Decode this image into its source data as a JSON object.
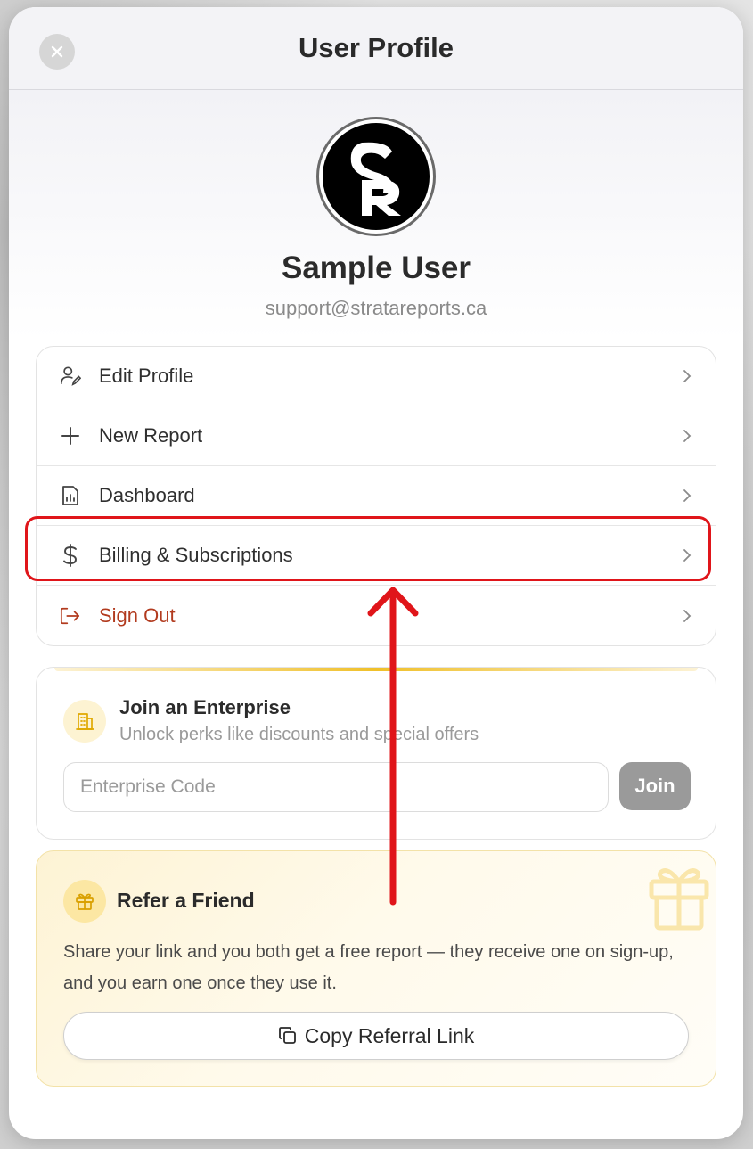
{
  "header": {
    "title": "User Profile",
    "close_icon": "close-icon"
  },
  "profile": {
    "avatar_initials": "SR",
    "name": "Sample User",
    "email": "support@stratareports.ca"
  },
  "menu": {
    "items": [
      {
        "label": "Edit Profile",
        "icon": "user-edit-icon"
      },
      {
        "label": "New Report",
        "icon": "plus-icon"
      },
      {
        "label": "Dashboard",
        "icon": "report-chart-icon"
      },
      {
        "label": "Billing & Subscriptions",
        "icon": "dollar-icon"
      },
      {
        "label": "Sign Out",
        "icon": "sign-out-icon"
      }
    ]
  },
  "enterprise": {
    "title": "Join an Enterprise",
    "subtitle": "Unlock perks like discounts and special offers",
    "input_placeholder": "Enterprise Code",
    "input_value": "",
    "join_label": "Join"
  },
  "referral": {
    "title": "Refer a Friend",
    "description": "Share your link and you both get a free report — they receive one on sign-up, and you earn one once they use it.",
    "button_label": "Copy Referral Link"
  },
  "colors": {
    "highlight": "#e0151a",
    "danger": "#b23b1f",
    "accent": "#f0c02a"
  }
}
